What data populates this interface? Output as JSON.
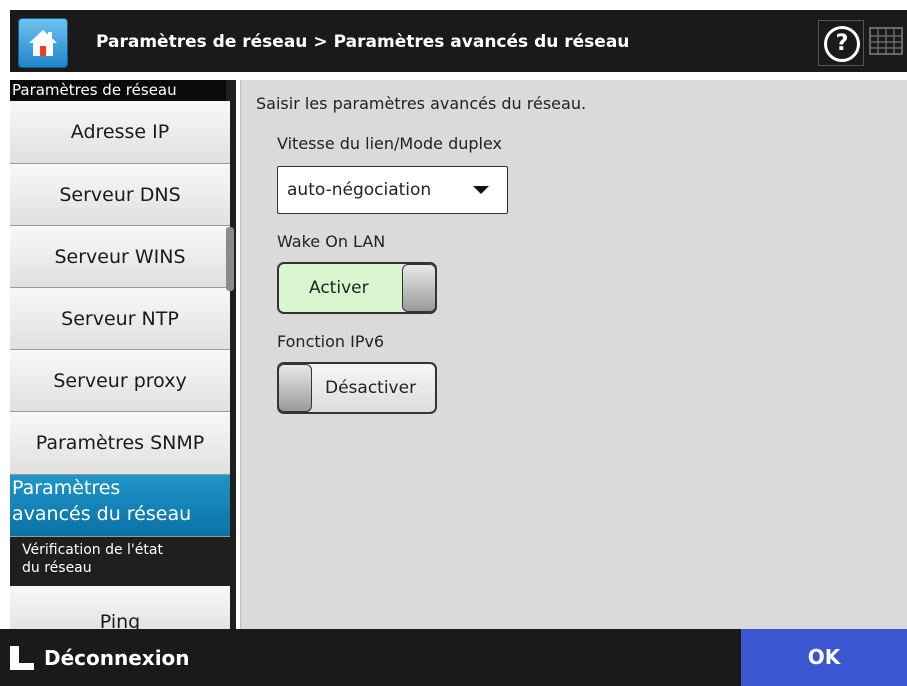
{
  "header": {
    "breadcrumb": [
      "Paramètres de réseau",
      "Paramètres avancés du réseau"
    ],
    "separator": ">",
    "help_label": "?"
  },
  "sidebar": {
    "title": "Paramètres de réseau",
    "items": [
      {
        "label": "Adresse IP"
      },
      {
        "label": "Serveur DNS"
      },
      {
        "label": "Serveur WINS"
      },
      {
        "label": "Serveur NTP"
      },
      {
        "label": "Serveur proxy"
      },
      {
        "label": "Paramètres SNMP"
      },
      {
        "label_line1": "Paramètres",
        "label_line2": "avancés du réseau"
      }
    ],
    "section2_title_line1": "Vérification de l'état",
    "section2_title_line2": "du réseau",
    "section2_items": [
      {
        "label": "Ping"
      }
    ]
  },
  "main": {
    "description": "Saisir les paramètres avancés du réseau.",
    "link_speed": {
      "label": "Vitesse du lien/Mode duplex",
      "value": "auto-négociation"
    },
    "wake_on_lan": {
      "label": "Wake On LAN",
      "state_label": "Activer"
    },
    "ipv6": {
      "label": "Fonction IPv6",
      "state_label": "Désactiver"
    }
  },
  "footer": {
    "logout_label": "Déconnexion",
    "ok_label": "OK"
  },
  "colors": {
    "active_item": "#0b72a6",
    "ok_button": "#3b56d1",
    "toggle_on": "#d8f5d0",
    "header_bg": "#1a1a1a"
  }
}
